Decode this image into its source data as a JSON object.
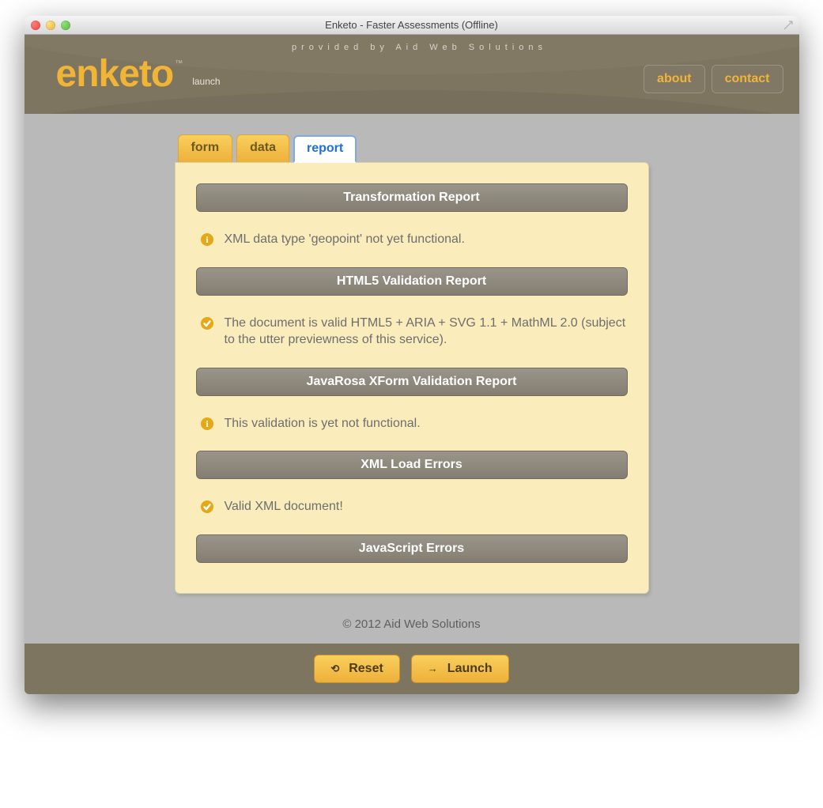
{
  "window": {
    "title": "Enketo - Faster Assessments (Offline)"
  },
  "header": {
    "tagline": "provided by Aid Web Solutions",
    "logo": "enketo",
    "logo_tm": "™",
    "logo_sub": "launch",
    "nav": {
      "about": "about",
      "contact": "contact"
    }
  },
  "tabs": {
    "form": "form",
    "data": "data",
    "report": "report",
    "active": "report"
  },
  "report": {
    "sections": [
      {
        "heading": "Transformation Report",
        "items": [
          {
            "icon": "info",
            "text": "XML data type 'geopoint' not yet functional."
          }
        ]
      },
      {
        "heading": "HTML5 Validation Report",
        "items": [
          {
            "icon": "check",
            "text": "The document is valid HTML5 + ARIA + SVG 1.1 + MathML 2.0 (subject to the utter previewness of this service)."
          }
        ]
      },
      {
        "heading": "JavaRosa XForm Validation Report",
        "items": [
          {
            "icon": "info",
            "text": "This validation is yet not functional."
          }
        ]
      },
      {
        "heading": "XML Load Errors",
        "items": [
          {
            "icon": "check",
            "text": "Valid XML document!"
          }
        ]
      },
      {
        "heading": "JavaScript Errors",
        "items": []
      }
    ]
  },
  "footer": "© 2012 Aid Web Solutions",
  "buttons": {
    "reset": "Reset",
    "launch": "Launch"
  }
}
